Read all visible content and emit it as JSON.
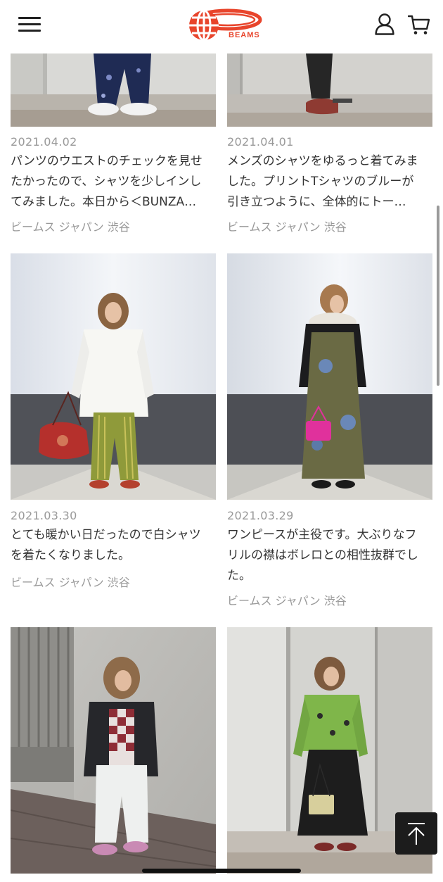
{
  "header": {
    "logo_text": "BEAMS",
    "menu_icon": "hamburger-menu-icon",
    "user_icon": "user-icon",
    "cart_icon": "cart-icon",
    "brand_color": "#e8452c"
  },
  "posts": [
    {
      "date": "2021.04.02",
      "description_line1": "パンツのウエストのチェックを見せ",
      "description_line2": "たかったので、シャツを少しインし",
      "description_line3": "てみました。本日から＜BUNZA…",
      "shop": "ビームス ジャパン 渋谷"
    },
    {
      "date": "2021.04.01",
      "description_line1": "メンズのシャツをゆるっと着てみま",
      "description_line2": "した。プリントTシャツのブルーが",
      "description_line3": "引き立つように、全体的にトー…",
      "shop": "ビームス ジャパン 渋谷"
    },
    {
      "date": "2021.03.30",
      "description_line1": "とても暖かい日だったので白シャツ",
      "description_line2": "を着たくなりました。",
      "description_line3": "",
      "shop": "ビームス ジャパン 渋谷"
    },
    {
      "date": "2021.03.29",
      "description_line1": "ワンピースが主役です。大ぶりなフ",
      "description_line2": "リルの襟はボレロとの相性抜群でし",
      "description_line3": "た。",
      "shop": "ビームス ジャパン 渋谷"
    },
    {},
    {}
  ],
  "back_to_top_icon": "arrow-up-to-top-icon"
}
